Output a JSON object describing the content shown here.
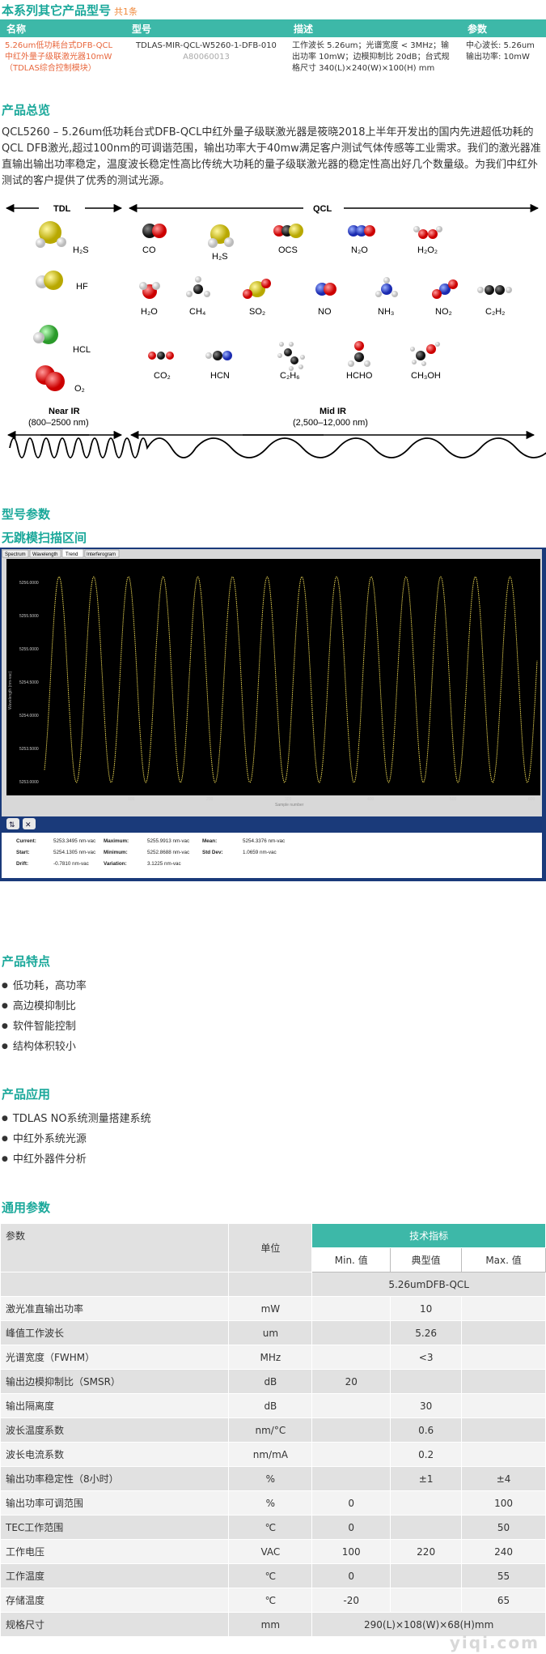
{
  "series": {
    "title": "本系列其它产品型号",
    "count": "共1条",
    "headers": [
      "名称",
      "型号",
      "描述",
      "参数"
    ],
    "row": {
      "name": "5.26um低功耗台式DFB-QCL中红外量子级联激光器10mW（TDLAS综合控制模块）",
      "model": "TDLAS-MIR-QCL-W5260-1-DFB-010",
      "code": "A80060013",
      "desc": "工作波长 5.26um；光谱宽度 < 3MHz；输出功率 10mW；边模抑制比 20dB；台式规格尺寸 340(L)×240(W)×100(H) mm",
      "param": "中心波长: 5.26um 输出功率: 10mW"
    }
  },
  "overview": {
    "title": "产品总览",
    "text": "QCL5260 – 5.26um低功耗台式DFB-QCL中红外量子级联激光器是筱晓2018上半年开发出的国内先进超低功耗的QCL DFB激光,超过100nm的可调谐范围，输出功率大于40mw满足客户测试气体传感等工业需求。我们的激光器准直输出输出功率稳定，温度波长稳定性高比传统大功耗的量子级联激光器的稳定性高出好几个数量级。为我们中红外测试的客户提供了优秀的测试光源。"
  },
  "spectrum": {
    "tdl": "TDL",
    "qcl": "QCL",
    "near_ir": "Near IR",
    "near_range": "(800–2500 nm)",
    "mid_ir": "Mid IR",
    "mid_range": "(2,500–12,000 nm)",
    "tdl_molecules": [
      "H₂S",
      "HF",
      "HCL",
      "O₂"
    ],
    "qcl_row1": [
      "CO",
      "H₂S",
      "OCS",
      "N₂O",
      "H₂O₂"
    ],
    "qcl_row2": [
      "H₂O",
      "CH₄",
      "SO₂",
      "NO",
      "NH₃",
      "NO₂",
      "C₂H₂"
    ],
    "qcl_row3": [
      "CO₂",
      "HCN",
      "C₂H₆",
      "HCHO",
      "CH₃OH"
    ]
  },
  "model_title": "型号参数",
  "scan_title": "无跳模扫描区间",
  "software": {
    "tabs": [
      "Spectrum",
      "Wavelength",
      "Trend",
      "Interferogram"
    ],
    "yticks": [
      "5256.0000",
      "5255.5000",
      "5255.0000",
      "5254.5000",
      "5254.0000",
      "5253.5000",
      "5253.0000"
    ],
    "ylabel": "Wavelength (nm-vac)",
    "xticks": [
      "100",
      "200",
      "300",
      "400",
      "500",
      "600"
    ],
    "xlabel": "Sample number",
    "stats": [
      [
        "Current:",
        "5253.3495 nm-vac",
        "Maximum:",
        "5255.9913 nm-vac",
        "Mean:",
        "5254.3376 nm-vac"
      ],
      [
        "Start:",
        "5254.1305 nm-vac",
        "Minimum:",
        "5252.8688 nm-vac",
        "Std Dev:",
        "1.0659 nm-vac"
      ],
      [
        "Drift:",
        "-0.7810 nm-vac",
        "Variation:",
        "3.1225 nm-vac",
        "",
        ""
      ]
    ]
  },
  "features": {
    "title": "产品特点",
    "items": [
      "低功耗，高功率",
      "高边模抑制比",
      "软件智能控制",
      "结构体积较小"
    ]
  },
  "apps": {
    "title": "产品应用",
    "items": [
      "TDLAS NO系统测量搭建系统",
      "中红外系统光源",
      "中红外器件分析"
    ]
  },
  "general": {
    "title": "通用参数",
    "h_param": "参数",
    "h_unit": "单位",
    "h_spec": "技术指标",
    "h_min": "Min. 值",
    "h_typ": "典型值",
    "h_max": "Max. 值",
    "model_row": "5.26umDFB-QCL",
    "rows": [
      [
        "激光准直输出功率",
        "mW",
        "",
        "10",
        ""
      ],
      [
        "峰值工作波长",
        "um",
        "",
        "5.26",
        ""
      ],
      [
        "光谱宽度（FWHM）",
        "MHz",
        "",
        "<3",
        ""
      ],
      [
        "输出边模抑制比（SMSR）",
        "dB",
        "20",
        "",
        ""
      ],
      [
        "输出隔离度",
        "dB",
        "",
        "30",
        ""
      ],
      [
        "波长温度系数",
        "nm/°C",
        "",
        "0.6",
        ""
      ],
      [
        "波长电流系数",
        "nm/mA",
        "",
        "0.2",
        ""
      ],
      [
        "输出功率稳定性（8小时）",
        "%",
        "",
        "±1",
        "±4"
      ],
      [
        "输出功率可调范围",
        "%",
        "0",
        "",
        "100"
      ],
      [
        "TEC工作范围",
        "℃",
        "0",
        "",
        "50"
      ],
      [
        "工作电压",
        "VAC",
        "100",
        "220",
        "240"
      ],
      [
        "工作温度",
        "℃",
        "0",
        "",
        "55"
      ],
      [
        "存储温度",
        "℃",
        "-20",
        "",
        "65"
      ]
    ],
    "size_row": [
      "规格尺寸",
      "mm",
      "290(L)×108(W)×68(H)mm"
    ]
  }
}
